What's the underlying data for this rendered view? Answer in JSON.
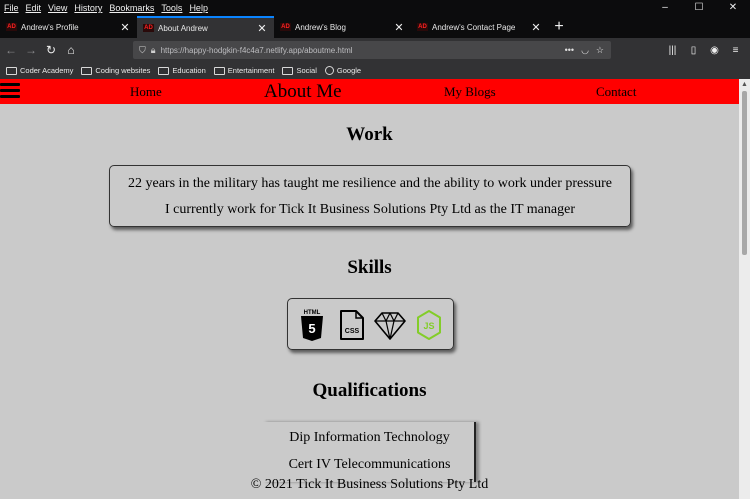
{
  "menubar": {
    "items": [
      "File",
      "Edit",
      "View",
      "History",
      "Bookmarks",
      "Tools",
      "Help"
    ]
  },
  "window": {
    "minimize": "–",
    "maximize": "☐",
    "close": "✕"
  },
  "tabs": [
    {
      "title": "Andrew's Profile",
      "favicon": "AD"
    },
    {
      "title": "About Andrew",
      "favicon": "AD"
    },
    {
      "title": "Andrew's Blog",
      "favicon": "AD"
    },
    {
      "title": "Andrew's Contact Page",
      "favicon": "AD"
    }
  ],
  "address": {
    "url": "https://happy-hodgkin-f4c4a7.netlify.app/aboutme.html"
  },
  "bookmarks": [
    {
      "label": "Coder Academy",
      "icon": "folder-icon"
    },
    {
      "label": "Coding websites",
      "icon": "folder-icon"
    },
    {
      "label": "Education",
      "icon": "folder-icon"
    },
    {
      "label": "Entertainment",
      "icon": "folder-icon"
    },
    {
      "label": "Social",
      "icon": "folder-icon"
    },
    {
      "label": "Google",
      "icon": "globe-icon"
    }
  ],
  "site": {
    "nav": {
      "home": "Home",
      "about": "About Me",
      "blogs": "My Blogs",
      "contact": "Contact"
    },
    "work": {
      "heading": "Work",
      "line1": "22 years in the military has taught me resilience and the ability to work under pressure",
      "line2": "I currently work for Tick It Business Solutions Pty Ltd as the IT manager"
    },
    "skills": {
      "heading": "Skills",
      "items": [
        "HTML",
        "CSS",
        "Sketch",
        "Node.js"
      ],
      "html_label": "HTML",
      "html_num": "5",
      "css_label": "CSS",
      "js_label": "JS",
      "node_color": "#83cd29"
    },
    "qualifications": {
      "heading": "Qualifications",
      "items": [
        "Dip Information Technology",
        "Cert IV Telecommunications"
      ]
    },
    "footer": "© 2021 Tick It Business Solutions Pty Ltd"
  },
  "colors": {
    "site_nav": "#ff0000",
    "page_bg": "#cacaca",
    "tab_accent": "#0a84ff"
  }
}
